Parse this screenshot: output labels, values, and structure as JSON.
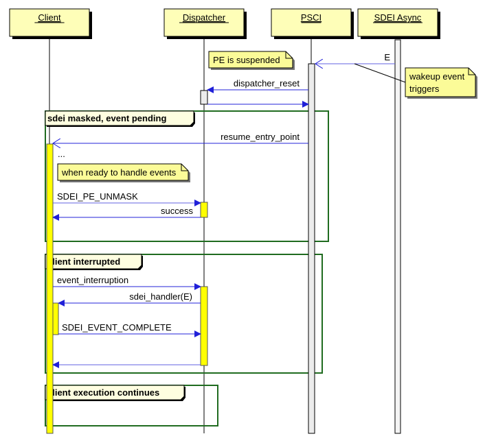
{
  "diagram": {
    "type": "sequence",
    "colors": {
      "participant_fill": "#fefeb8",
      "note_fill": "#fbfb98",
      "message_line": "#2020d8",
      "message_line_light": "#6060e0",
      "frame_border": "#1f6b1f",
      "frame_label_fill": "#fefee0",
      "activation_yellow": "#ffff00",
      "activation_gray": "#ececec"
    },
    "participants": [
      {
        "id": "client",
        "label": "Client"
      },
      {
        "id": "dispatcher",
        "label": "Dispatcher"
      },
      {
        "id": "psci",
        "label": "PSCI"
      },
      {
        "id": "sdei_async",
        "label": "SDEI Async"
      }
    ],
    "notes": [
      {
        "id": "pe-suspended",
        "text": [
          "PE is suspended"
        ]
      },
      {
        "id": "wakeup",
        "text": [
          "wakeup event",
          "triggers"
        ]
      },
      {
        "id": "ready",
        "text": [
          "when ready to handle events"
        ]
      }
    ],
    "messages": [
      {
        "id": "e",
        "from": "sdei_async",
        "to": "psci",
        "label": "E",
        "style": "open"
      },
      {
        "id": "dispatcher-reset",
        "from": "psci",
        "to": "dispatcher",
        "label": "dispatcher_reset",
        "style": "filled"
      },
      {
        "id": "dispatcher-return",
        "from": "dispatcher",
        "to": "psci",
        "label": "",
        "style": "filled"
      },
      {
        "id": "resume-entry-point",
        "from": "psci",
        "to": "client",
        "label": "resume_entry_point",
        "style": "open"
      },
      {
        "id": "sdei-pe-unmask",
        "from": "client",
        "to": "dispatcher",
        "label": "SDEI_PE_UNMASK",
        "style": "filled"
      },
      {
        "id": "success",
        "from": "dispatcher",
        "to": "client",
        "label": "success",
        "style": "filled"
      },
      {
        "id": "event-interruption",
        "from": "client",
        "to": "dispatcher",
        "label": "event_interruption",
        "style": "filled"
      },
      {
        "id": "sdei-handler",
        "from": "dispatcher",
        "to": "client",
        "label": "sdei_handler(E)",
        "style": "filled"
      },
      {
        "id": "sdei-event-complete",
        "from": "client",
        "to": "dispatcher",
        "label": "SDEI_EVENT_COMPLETE",
        "style": "filled"
      },
      {
        "id": "return-to-client",
        "from": "dispatcher",
        "to": "client",
        "label": "",
        "style": "filled"
      }
    ],
    "ellipsis": "...",
    "frames": [
      {
        "id": "sdei-masked",
        "label": "sdei masked, event pending"
      },
      {
        "id": "client-interrupted",
        "label": "client interrupted"
      },
      {
        "id": "client-execution",
        "label": "client execution continues"
      }
    ]
  }
}
